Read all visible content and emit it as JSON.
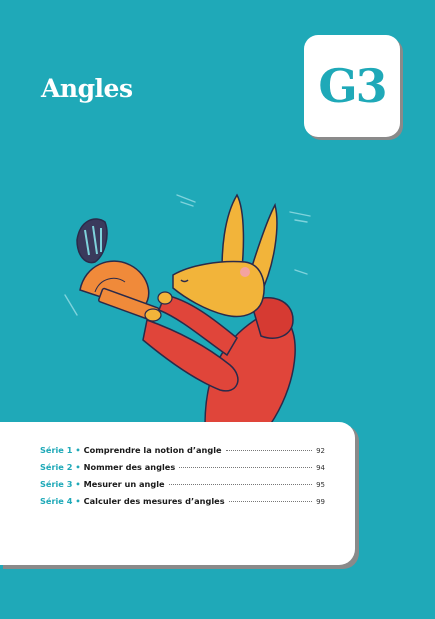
{
  "header": {
    "title": "Angles",
    "badge": "G3"
  },
  "toc": [
    {
      "serie": "Série 1",
      "topic": "Comprendre la notion d’angle",
      "page": "92"
    },
    {
      "serie": "Série 2",
      "topic": "Nommer des angles",
      "page": "94"
    },
    {
      "serie": "Série 3",
      "topic": "Mesurer un angle",
      "page": "95"
    },
    {
      "serie": "Série 4",
      "topic": "Calculer des mesures d’angles",
      "page": "99"
    }
  ],
  "colors": {
    "background": "#1fa9b8",
    "accent": "#1fa9b8",
    "card": "#ffffff",
    "hoodie": "#e0453a",
    "protractor": "#f08a3a",
    "creature": "#f2b43a"
  },
  "illustration": {
    "subject": "kangaroo-with-protractor-icon"
  }
}
